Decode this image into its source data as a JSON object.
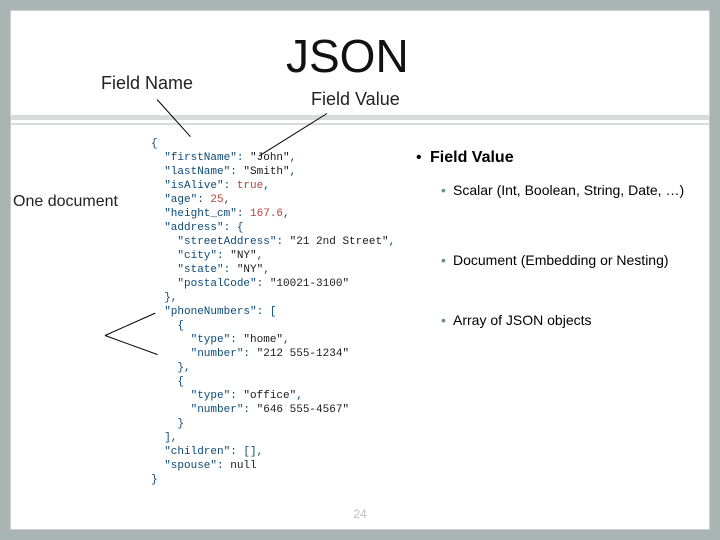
{
  "title": "JSON",
  "header_labels": {
    "field_name": "Field Name",
    "field_value": "Field Value"
  },
  "side_label": "One document",
  "page_number": "24",
  "bullets": {
    "heading": "Field Value",
    "items": [
      "Scalar (Int, Boolean, String, Date, …)",
      "Document (Embedding or Nesting)",
      "Array of JSON objects"
    ]
  },
  "code": {
    "l0": "{",
    "l1_k": "\"firstName\"",
    "l1_v": "\"John\"",
    "l2_k": "\"lastName\"",
    "l2_v": "\"Smith\"",
    "l3_k": "\"isAlive\"",
    "l3_v": "true",
    "l4_k": "\"age\"",
    "l4_v": "25",
    "l5_k": "\"height_cm\"",
    "l5_v": "167.6",
    "l6_k": "\"address\"",
    "l7_k": "\"streetAddress\"",
    "l7_v": "\"21 2nd Street\"",
    "l8_k": "\"city\"",
    "l8_v": "\"NY\"",
    "l9_k": "\"state\"",
    "l9_v": "\"NY\"",
    "l10_k": "\"postalCode\"",
    "l10_v": "\"10021-3100\"",
    "l11": "},",
    "l12_k": "\"phoneNumbers\"",
    "l13": "{",
    "l14_k": "\"type\"",
    "l14_v": "\"home\"",
    "l15_k": "\"number\"",
    "l15_v": "\"212 555-1234\"",
    "l16": "},",
    "l17": "{",
    "l18_k": "\"type\"",
    "l18_v": "\"office\"",
    "l19_k": "\"number\"",
    "l19_v": "\"646 555-4567\"",
    "l20": "}",
    "l21": "],",
    "l22_k": "\"children\"",
    "l23_k": "\"spouse\"",
    "l23_v": "null",
    "l24": "}"
  }
}
